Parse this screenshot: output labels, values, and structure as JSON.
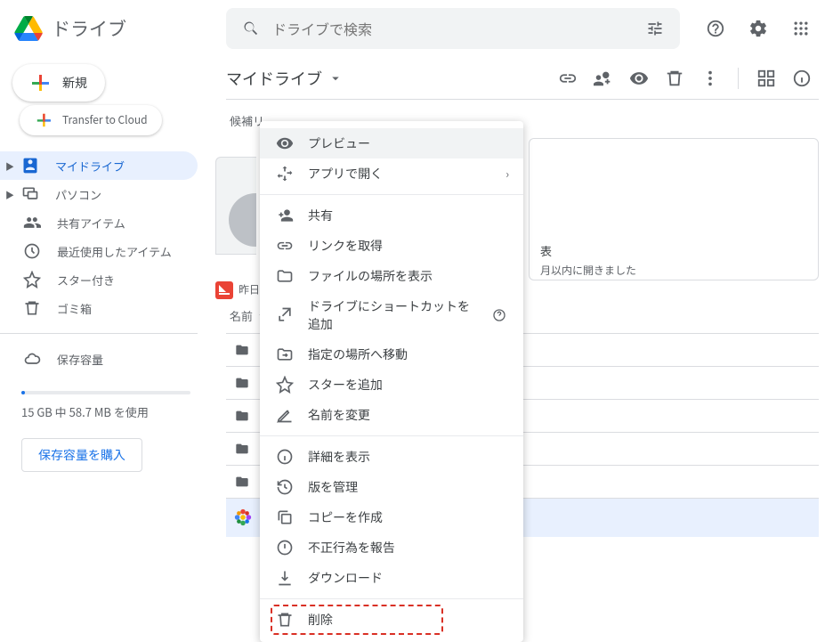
{
  "app": {
    "name": "ドライブ"
  },
  "search": {
    "placeholder": "ドライブで検索"
  },
  "sidebar": {
    "new_label": "新規",
    "transfer_label": "Transfer to Cloud",
    "items": [
      {
        "label": "マイドライブ"
      },
      {
        "label": "パソコン"
      },
      {
        "label": "共有アイテム"
      },
      {
        "label": "最近使用したアイテム"
      },
      {
        "label": "スター付き"
      },
      {
        "label": "ゴミ箱"
      }
    ],
    "storage_label": "保存容量",
    "storage_text": "15 GB 中 58.7 MB を使用",
    "buy_label": "保存容量を購入"
  },
  "toolbar": {
    "breadcrumb": "マイドライブ"
  },
  "content": {
    "suggest_label": "候補リ",
    "card_title": "表",
    "card_sub": "月以内に開きました",
    "left_detail": "昨日",
    "col_name": "名前"
  },
  "context_menu": {
    "items": [
      {
        "label": "プレビュー"
      },
      {
        "label": "アプリで開く"
      },
      {
        "label": "共有"
      },
      {
        "label": "リンクを取得"
      },
      {
        "label": "ファイルの場所を表示"
      },
      {
        "label": "ドライブにショートカットを追加"
      },
      {
        "label": "指定の場所へ移動"
      },
      {
        "label": "スターを追加"
      },
      {
        "label": "名前を変更"
      },
      {
        "label": "詳細を表示"
      },
      {
        "label": "版を管理"
      },
      {
        "label": "コピーを作成"
      },
      {
        "label": "不正行為を報告"
      },
      {
        "label": "ダウンロード"
      },
      {
        "label": "削除"
      }
    ]
  }
}
